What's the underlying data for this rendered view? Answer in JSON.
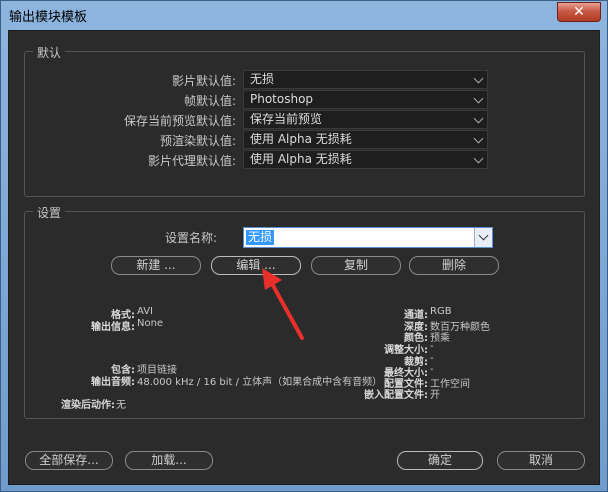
{
  "window": {
    "title": "输出模块模板",
    "close_glyph": "✕"
  },
  "defaults": {
    "label": "默认",
    "rows": [
      {
        "label": "影片默认值:",
        "value": "无损"
      },
      {
        "label": "帧默认值:",
        "value": "Photoshop"
      },
      {
        "label": "保存当前预览默认值:",
        "value": "保存当前预览"
      },
      {
        "label": "预渲染默认值:",
        "value": "使用 Alpha 无损耗"
      },
      {
        "label": "影片代理默认值:",
        "value": "使用 Alpha 无损耗"
      }
    ]
  },
  "settings": {
    "label": "设置",
    "name_label": "设置名称:",
    "name_value": "无损",
    "buttons": {
      "new": "新建 ...",
      "edit": "编辑 ...",
      "copy": "复制",
      "delete": "删除"
    },
    "info_left": [
      {
        "k": "格式:",
        "v": "AVI"
      },
      {
        "k": "输出信息:",
        "v": "None"
      },
      {
        "k": "包含:",
        "v": "项目链接"
      },
      {
        "k": "输出音频:",
        "v": "48.000 kHz / 16 bit / 立体声（如果合成中含有音频）"
      },
      {
        "k": "渲染后动作:",
        "v": "无"
      }
    ],
    "info_right": [
      {
        "k": "通道:",
        "v": "RGB"
      },
      {
        "k": "深度:",
        "v": "数百万种颜色"
      },
      {
        "k": "颜色:",
        "v": "预乘"
      },
      {
        "k": "调整大小:",
        "v": "-"
      },
      {
        "k": "裁剪:",
        "v": "-"
      },
      {
        "k": "最终大小:",
        "v": "-"
      },
      {
        "k": "配置文件:",
        "v": "工作空间"
      },
      {
        "k": "嵌入配置文件:",
        "v": "开"
      }
    ]
  },
  "footer": {
    "save_all": "全部保存...",
    "load": "加载...",
    "ok": "确定",
    "cancel": "取消"
  },
  "colors": {
    "dialog_bg": "#2b2b2b",
    "selection": "#3399ff",
    "arrow": "#e8302a"
  }
}
